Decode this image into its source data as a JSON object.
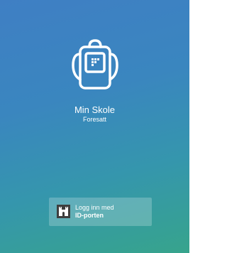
{
  "app": {
    "title": "Min Skole",
    "subtitle": "Foresatt",
    "logo_icon": "backpack-icon"
  },
  "login": {
    "line1": "Logg inn med",
    "line2": "ID-porten",
    "icon": "idporten-icon"
  },
  "colors": {
    "gradient_top": "#3f7fc4",
    "gradient_bottom": "#37a48c",
    "text": "#ffffff",
    "icon_tile": "#3e3e3e"
  }
}
